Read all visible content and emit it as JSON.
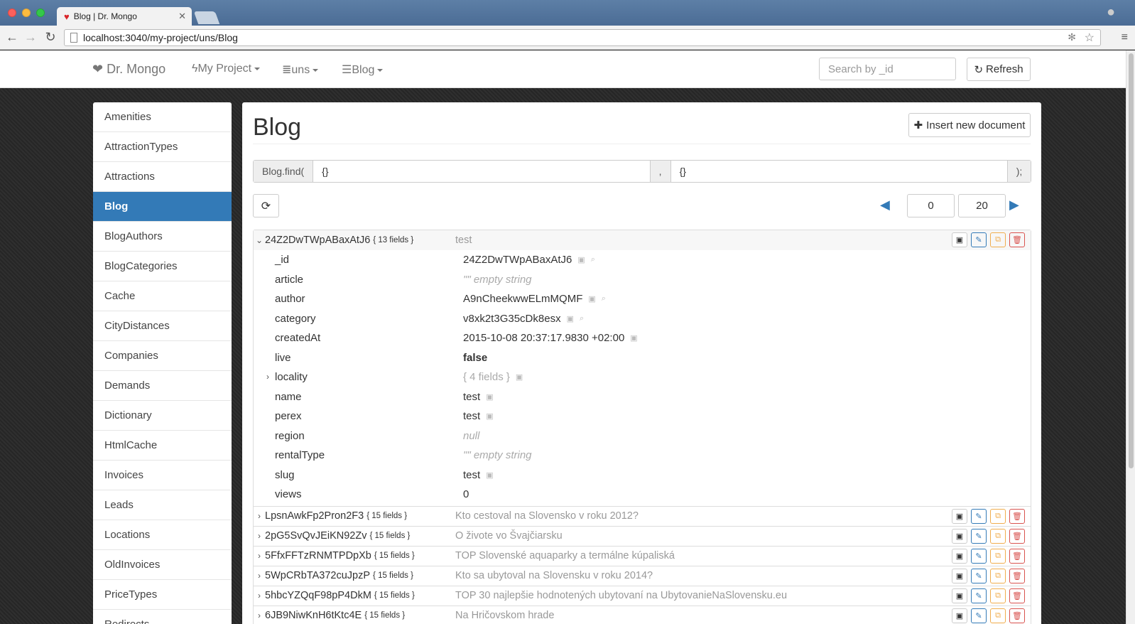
{
  "browser": {
    "tab_title": "Blog | Dr. Mongo",
    "url": "localhost:3040/my-project/uns/Blog"
  },
  "navbar": {
    "brand": "Dr. Mongo",
    "project": "My Project",
    "database": "uns",
    "collection": "Blog",
    "search_placeholder": "Search by _id",
    "refresh_label": "Refresh"
  },
  "sidebar": {
    "items": [
      "Amenities",
      "AttractionTypes",
      "Attractions",
      "Blog",
      "BlogAuthors",
      "BlogCategories",
      "Cache",
      "CityDistances",
      "Companies",
      "Demands",
      "Dictionary",
      "HtmlCache",
      "Invoices",
      "Leads",
      "Locations",
      "OldInvoices",
      "PriceTypes",
      "Redirects"
    ],
    "active": "Blog"
  },
  "main": {
    "title": "Blog",
    "insert_label": "Insert new document",
    "query": {
      "prefix": "Blog.find(",
      "selector": "{}",
      "separator": ",",
      "projection": "{}",
      "suffix": ");"
    },
    "pager": {
      "skip": "0",
      "limit": "20"
    }
  },
  "expanded_doc": {
    "id": "24Z2DwTWpABaxAtJ6",
    "field_count": "{ 13 fields }",
    "title": "test",
    "fields": [
      {
        "name": "_id",
        "value": "24Z2DwTWpABaxAtJ6"
      },
      {
        "name": "article",
        "value": "\"\" empty string"
      },
      {
        "name": "author",
        "value": "A9nCheekwwELmMQMF"
      },
      {
        "name": "category",
        "value": "v8xk2t3G35cDk8esx"
      },
      {
        "name": "createdAt",
        "value": "2015-10-08 20:37:17.9830 +02:00"
      },
      {
        "name": "live",
        "value": "false"
      },
      {
        "name": "locality",
        "value": "{ 4 fields }"
      },
      {
        "name": "name",
        "value": "test"
      },
      {
        "name": "perex",
        "value": "test"
      },
      {
        "name": "region",
        "value": "null"
      },
      {
        "name": "rentalType",
        "value": "\"\" empty string"
      },
      {
        "name": "slug",
        "value": "test"
      },
      {
        "name": "views",
        "value": "0"
      }
    ]
  },
  "docs": [
    {
      "id": "LpsnAwkFp2Pron2F3",
      "field_count": "{ 15 fields }",
      "title": "Kto cestoval na Slovensko v roku 2012?"
    },
    {
      "id": "2pG5SvQvJEiKN92Zv",
      "field_count": "{ 15 fields }",
      "title": "O živote vo Švajčiarsku"
    },
    {
      "id": "5FfxFFTzRNMTPDpXb",
      "field_count": "{ 15 fields }",
      "title": "TOP Slovenské aquaparky a termálne kúpaliská"
    },
    {
      "id": "5WpCRbTA372cuJpzP",
      "field_count": "{ 15 fields }",
      "title": "Kto sa ubytoval na Slovensku v roku 2014?"
    },
    {
      "id": "5hbcYZQqF98pP4DkM",
      "field_count": "{ 15 fields }",
      "title": "TOP 30 najlepšie hodnotených ubytovaní na UbytovanieNaSlovensku.eu"
    },
    {
      "id": "6JB9NiwKnH6tKtc4E",
      "field_count": "{ 15 fields }",
      "title": "Na Hričovskom hrade"
    }
  ]
}
